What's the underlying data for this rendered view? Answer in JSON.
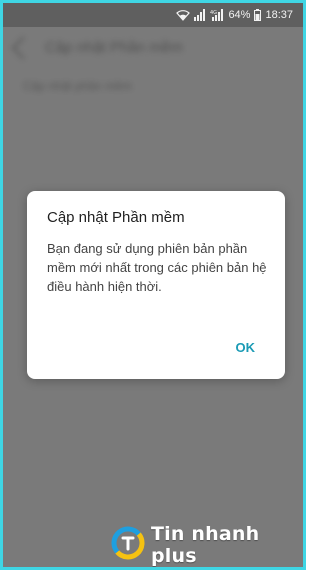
{
  "status_bar": {
    "battery_percent": "64%",
    "time": "18:37",
    "network_label": "4G",
    "icons": [
      "wifi-icon",
      "signal-icon",
      "signal-4g-icon",
      "battery-icon"
    ]
  },
  "background_app": {
    "title": "Cập nhật Phần mềm",
    "subtitle": "Cập nhật phần mềm"
  },
  "dialog": {
    "title": "Cập nhật Phần mềm",
    "message": "Bạn đang sử dụng phiên bản phần mềm mới nhất trong các phiên bản hệ điều hành hiện thời.",
    "ok_label": "OK",
    "accent_color": "#1b9bb5"
  },
  "watermark": {
    "brand": "Tin nhanh plus"
  },
  "colors": {
    "frame_border": "#3fd6e4",
    "overlay": "#7a7a7a",
    "dialog_bg": "#ffffff"
  }
}
